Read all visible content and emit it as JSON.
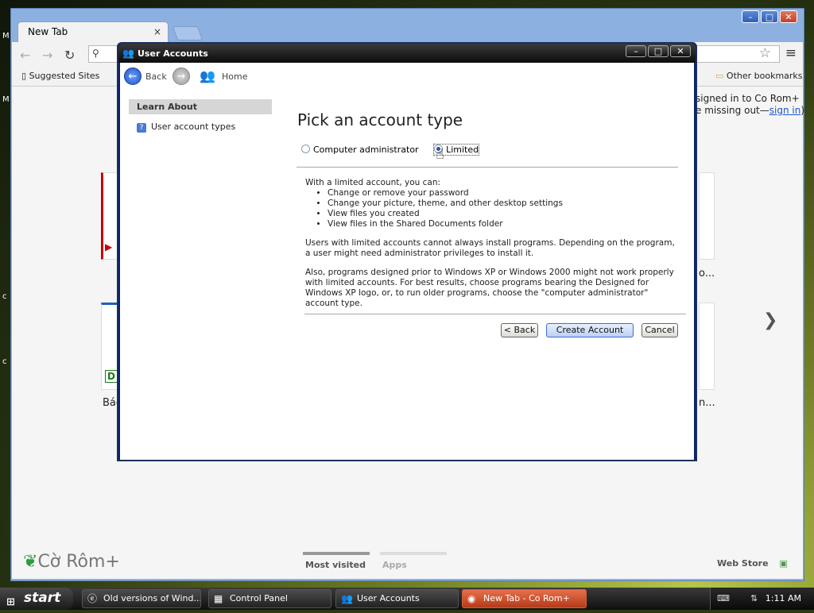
{
  "browser": {
    "tab_title": "New Tab",
    "tab_close": "×",
    "bookmarks": {
      "suggested_sites": "Suggested Sites",
      "other_bookmarks": "Other bookmarks"
    },
    "signin_line1": "signed in to Co Rom+",
    "signin_line2_prefix": "e missing out—",
    "signin_link": "sign in",
    "signin_line2_suffix": ")",
    "thumb_captions": [
      "Bác",
      "o...",
      "n..."
    ],
    "brand": "Cờ Rôm+",
    "bottom_tabs": [
      "Most visited",
      "Apps"
    ],
    "web_store": "Web Store"
  },
  "window": {
    "title": "User Accounts",
    "nav": {
      "back": "Back",
      "home": "Home"
    },
    "sidebar": {
      "header": "Learn About",
      "items": [
        "User account types"
      ]
    },
    "heading": "Pick an account type",
    "options": [
      {
        "label": "Computer administrator",
        "selected": false
      },
      {
        "label": "Limited",
        "selected": true
      }
    ],
    "intro": "With a limited account, you can:",
    "capabilities": [
      "Change or remove your password",
      "Change your picture, theme, and other desktop settings",
      "View files you created",
      "View files in the Shared Documents folder"
    ],
    "para1": "Users with limited accounts cannot always install programs. Depending on the program, a user might need administrator privileges to install it.",
    "para2": "Also, programs designed prior to Windows XP or Windows 2000 might not work properly with limited accounts. For best results, choose programs bearing the Designed for Windows XP logo, or, to run older programs, choose the \"computer administrator\" account type.",
    "buttons": {
      "back": "< Back",
      "create": "Create Account",
      "cancel": "Cancel"
    }
  },
  "taskbar": {
    "start": "start",
    "items": [
      {
        "label": "Old versions of Wind...",
        "icon": "ie-icon",
        "active": false
      },
      {
        "label": "Control Panel",
        "icon": "control-panel-icon",
        "active": false
      },
      {
        "label": "User Accounts",
        "icon": "users-icon",
        "active": false
      },
      {
        "label": "New Tab - Co Rom+",
        "icon": "chrome-icon",
        "active": true
      }
    ],
    "clock": "1:11 AM"
  },
  "colors": {
    "taskbar_active": "#d9532b",
    "link": "#1a56c9",
    "brand_green": "#2e9b3e"
  }
}
